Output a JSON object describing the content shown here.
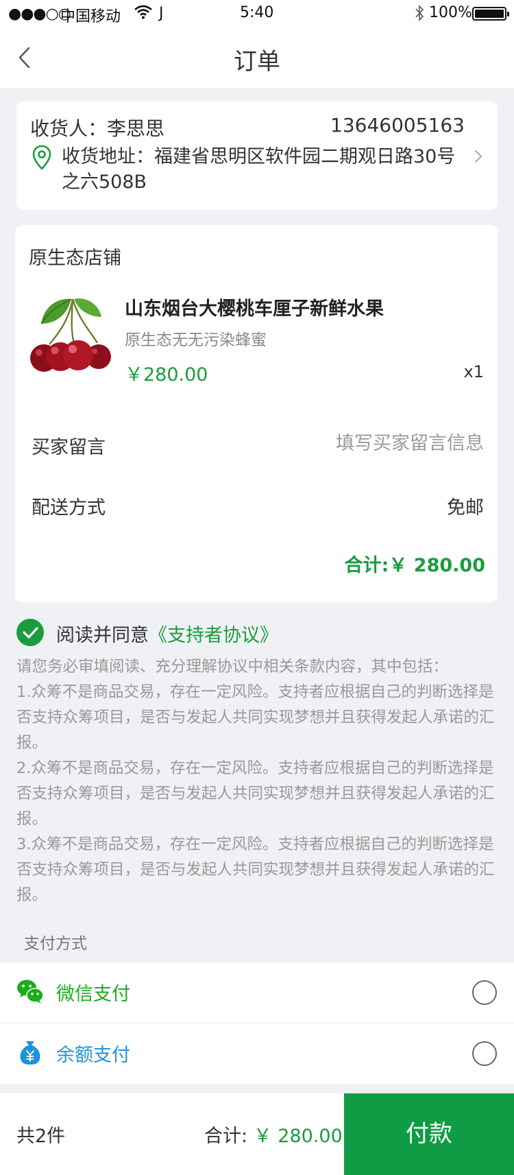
{
  "status_bar": {
    "signal": "●●●○○",
    "carrier": "中国移动",
    "j": "J",
    "time": "5:40",
    "battery": "100%"
  },
  "nav": {
    "title": "订单",
    "back_icon": "chevron-left-icon"
  },
  "address": {
    "receiver": "收货人：李思思",
    "phone": "13646005163",
    "address": "收货地址：福建省思明区软件园二期观日路30号之六508B",
    "pin_icon": "location-pin-icon",
    "chevron_icon": "chevron-right-icon"
  },
  "shop": {
    "name": "原生态店铺",
    "product": {
      "title": "山东烟台大樱桃车厘子新鲜水果",
      "subtitle": "原生态无无污染蜂蜜",
      "price": "￥280.00",
      "qty": "x1",
      "image": "cherries"
    },
    "message_label": "买家留言",
    "message_placeholder": "填写买家留言信息",
    "message_value": "",
    "delivery_label": "配送方式",
    "delivery_value": "免邮",
    "total": "合计:￥ 280.00"
  },
  "agreement": {
    "checked": true,
    "prefix": "阅读并同意",
    "link": "《支持者协议》",
    "terms": [
      "请您务必审填阅读、充分理解协议中相关条款内容，其中包括：",
      "1.众筹不是商品交易，存在一定风险。支持者应根据自己的判断选择是否支持众筹项目，是否与发起人共同实现梦想并且获得发起人承诺的汇报。",
      "2.众筹不是商品交易，存在一定风险。支持者应根据自己的判断选择是否支持众筹项目，是否与发起人共同实现梦想并且获得发起人承诺的汇报。",
      "3.众筹不是商品交易，存在一定风险。支持者应根据自己的判断选择是否支持众筹项目，是否与发起人共同实现梦想并且获得发起人承诺的汇报。"
    ]
  },
  "payment": {
    "title": "支付方式",
    "methods": [
      {
        "label": "微信支付",
        "icon": "wechat-icon",
        "color": "#1aad19",
        "selected": false
      },
      {
        "label": "余额支付",
        "icon": "money-bag-icon",
        "color": "#1e93d9",
        "selected": false
      }
    ]
  },
  "bottom": {
    "count": "共2件",
    "sum_label": "合计: ",
    "sum_amount": "￥ 280.00",
    "pay_button": "付款"
  },
  "colors": {
    "accent": "#1a9c3e",
    "pay_button": "#0f9c45",
    "background": "#f0f1f5"
  }
}
